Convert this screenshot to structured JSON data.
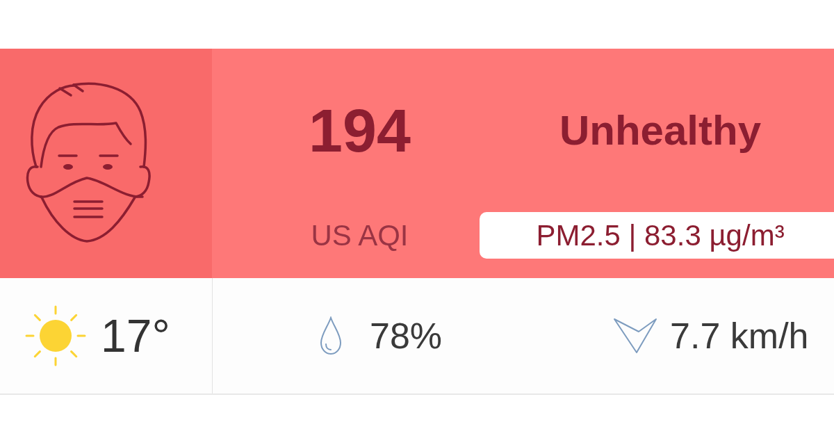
{
  "aqi": {
    "value": "194",
    "scale": "US AQI",
    "status": "Unhealthy",
    "pollutant": "PM2.5 | 83.3 µg/m³"
  },
  "weather": [
    {
      "kind": "temperature",
      "value": "17°"
    },
    {
      "kind": "humidity",
      "value": "78%"
    },
    {
      "kind": "wind",
      "value": "7.7 km/h"
    }
  ]
}
